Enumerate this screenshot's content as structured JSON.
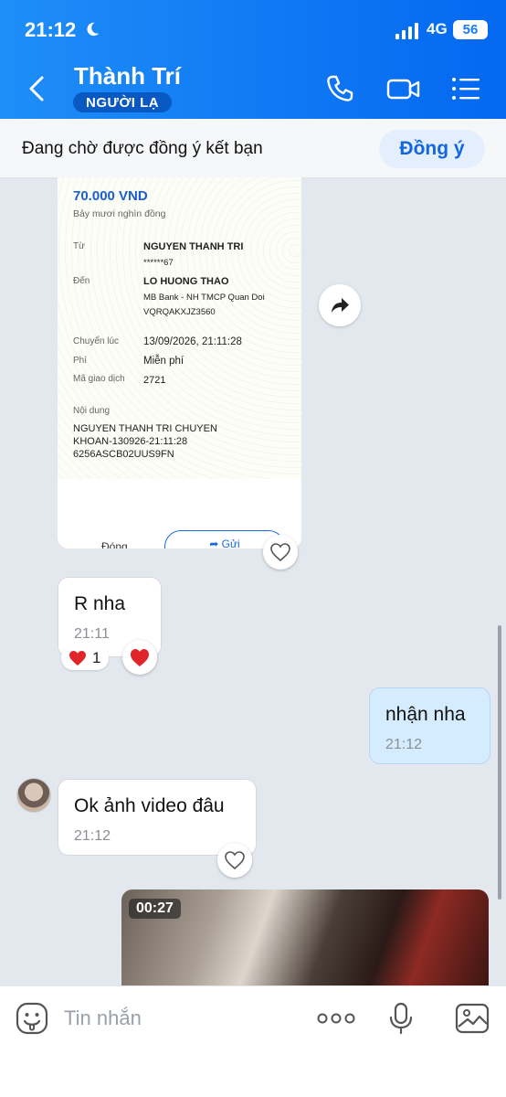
{
  "status_bar": {
    "time": "21:12",
    "network": "4G",
    "battery": "56"
  },
  "header": {
    "title": "Thành Trí",
    "badge": "NGƯỜI LẠ"
  },
  "friend_banner": {
    "text": "Đang chờ được đồng ý kết bạn",
    "button": "Đồng ý"
  },
  "receipt": {
    "amount": "70.000 VND",
    "amount_words": "Bảy mươi nghìn đồng",
    "from_label": "Từ",
    "from_name": "NGUYEN THANH TRI",
    "from_account": "******67",
    "to_label": "Đến",
    "to_name": "LO HUONG THAO",
    "to_bank": "MB Bank - NH TMCP Quan Doi",
    "to_account": "VQRQAKXJZ3560",
    "time_label": "Chuyển lúc",
    "time_value": "13/09/2026, 21:11:28",
    "fee_label": "Phí",
    "fee_value": "Miễn phí",
    "code_label": "Mã giao dịch",
    "code_value": "2721",
    "content_label": "Nội dung",
    "content_line1": "NGUYEN THANH TRI CHUYEN",
    "content_line2": "KHOAN-130926-21:11:28",
    "content_line3": "6256ASCB02UUS9FN",
    "close_label": "Đóng",
    "send_label": "Gửi"
  },
  "messages": [
    {
      "text": "R nha",
      "time": "21:11",
      "reaction_count": "1"
    },
    {
      "text": "nhận nha",
      "time": "21:12"
    },
    {
      "text": "Ok ảnh video đâu",
      "time": "21:12"
    }
  ],
  "video": {
    "duration": "00:27"
  },
  "input": {
    "placeholder": "Tin nhắn"
  },
  "colors": {
    "header": "#0a72f5",
    "accent": "#1466e0",
    "outgoing_bubble": "#d5ecfe"
  },
  "icons": [
    "back-icon",
    "phone-icon",
    "video-call-icon",
    "menu-icon",
    "share-icon",
    "heart-icon",
    "emoji-icon",
    "more-icon",
    "mic-icon",
    "image-icon"
  ]
}
